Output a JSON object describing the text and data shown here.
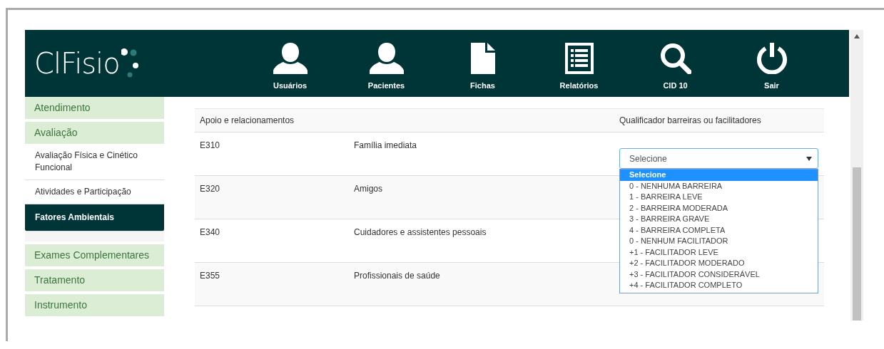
{
  "logo": {
    "text": "ClFisio"
  },
  "nav": [
    {
      "label": "Usuários"
    },
    {
      "label": "Pacientes"
    },
    {
      "label": "Fichas"
    },
    {
      "label": "Relatórios"
    },
    {
      "label": "CID 10"
    },
    {
      "label": "Sair"
    }
  ],
  "sidebar": {
    "items": [
      {
        "label": "Atendimento",
        "kind": "section",
        "selected": false
      },
      {
        "label": "Avaliação",
        "kind": "section",
        "selected": false
      },
      {
        "label": "Avaliação Física e Cinético Funcional",
        "kind": "sub",
        "selected": false
      },
      {
        "label": "Atividades e Participação",
        "kind": "sub",
        "selected": false
      },
      {
        "label": "Fatores Ambientais",
        "kind": "sub",
        "selected": true
      },
      {
        "label": "Exames Complementares",
        "kind": "section",
        "selected": false
      },
      {
        "label": "Tratamento",
        "kind": "section",
        "selected": false
      },
      {
        "label": "Instrumento",
        "kind": "section",
        "selected": false
      }
    ]
  },
  "table": {
    "columns": [
      "Apoio e relacionamentos",
      "Qualificador barreiras ou facilitadores"
    ],
    "rows": [
      {
        "code": "E310",
        "name": "Família imediata",
        "select": "Selecione"
      },
      {
        "code": "E320",
        "name": "Amigos"
      },
      {
        "code": "E340",
        "name": "Cuidadores e assistentes pessoais"
      },
      {
        "code": "E355",
        "name": "Profissionais de saúde"
      }
    ]
  },
  "dropdown": {
    "options": [
      {
        "label": "Selecione",
        "selected": true
      },
      {
        "label": "0 - NENHUMA BARREIRA",
        "selected": false
      },
      {
        "label": "1 - BARREIRA LEVE",
        "selected": false
      },
      {
        "label": "2 - BARREIRA MODERADA",
        "selected": false
      },
      {
        "label": "3 - BARREIRA GRAVE",
        "selected": false
      },
      {
        "label": "4 - BARREIRA COMPLETA",
        "selected": false
      },
      {
        "label": "0 - NENHUM FACILITADOR",
        "selected": false
      },
      {
        "label": "+1 - FACILITADOR LEVE",
        "selected": false
      },
      {
        "label": "+2 - FACILITADOR MODERADO",
        "selected": false
      },
      {
        "label": "+3 - FACILITADOR CONSIDERÁVEL",
        "selected": false
      },
      {
        "label": "+4 - FACILITADOR COMPLETO",
        "selected": false
      }
    ]
  }
}
